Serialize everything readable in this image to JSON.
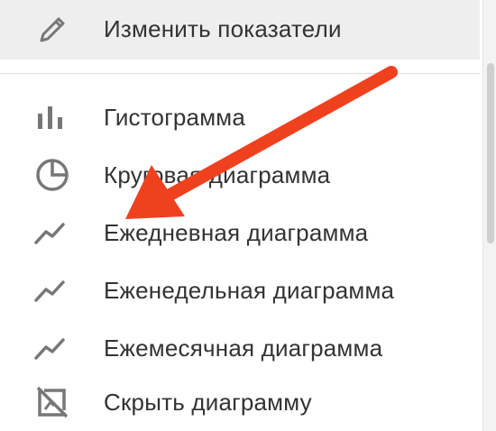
{
  "menu": {
    "edit_item": {
      "label": "Изменить показатели",
      "icon": "pencil-icon"
    },
    "items": [
      {
        "label": "Гистограмма",
        "icon": "bar-chart-icon"
      },
      {
        "label": "Круговая диаграмма",
        "icon": "pie-chart-icon"
      },
      {
        "label": "Ежедневная диаграмма",
        "icon": "line-chart-icon"
      },
      {
        "label": "Еженедельная диаграмма",
        "icon": "line-chart-icon"
      },
      {
        "label": "Ежемесячная диаграмма",
        "icon": "line-chart-icon"
      },
      {
        "label": "Скрыть диаграмму",
        "icon": "hide-chart-icon"
      }
    ]
  },
  "annotation": {
    "arrow_color": "#f0411f"
  },
  "colors": {
    "icon": "#777777",
    "text": "#333333",
    "highlight": "#eeeeee"
  }
}
